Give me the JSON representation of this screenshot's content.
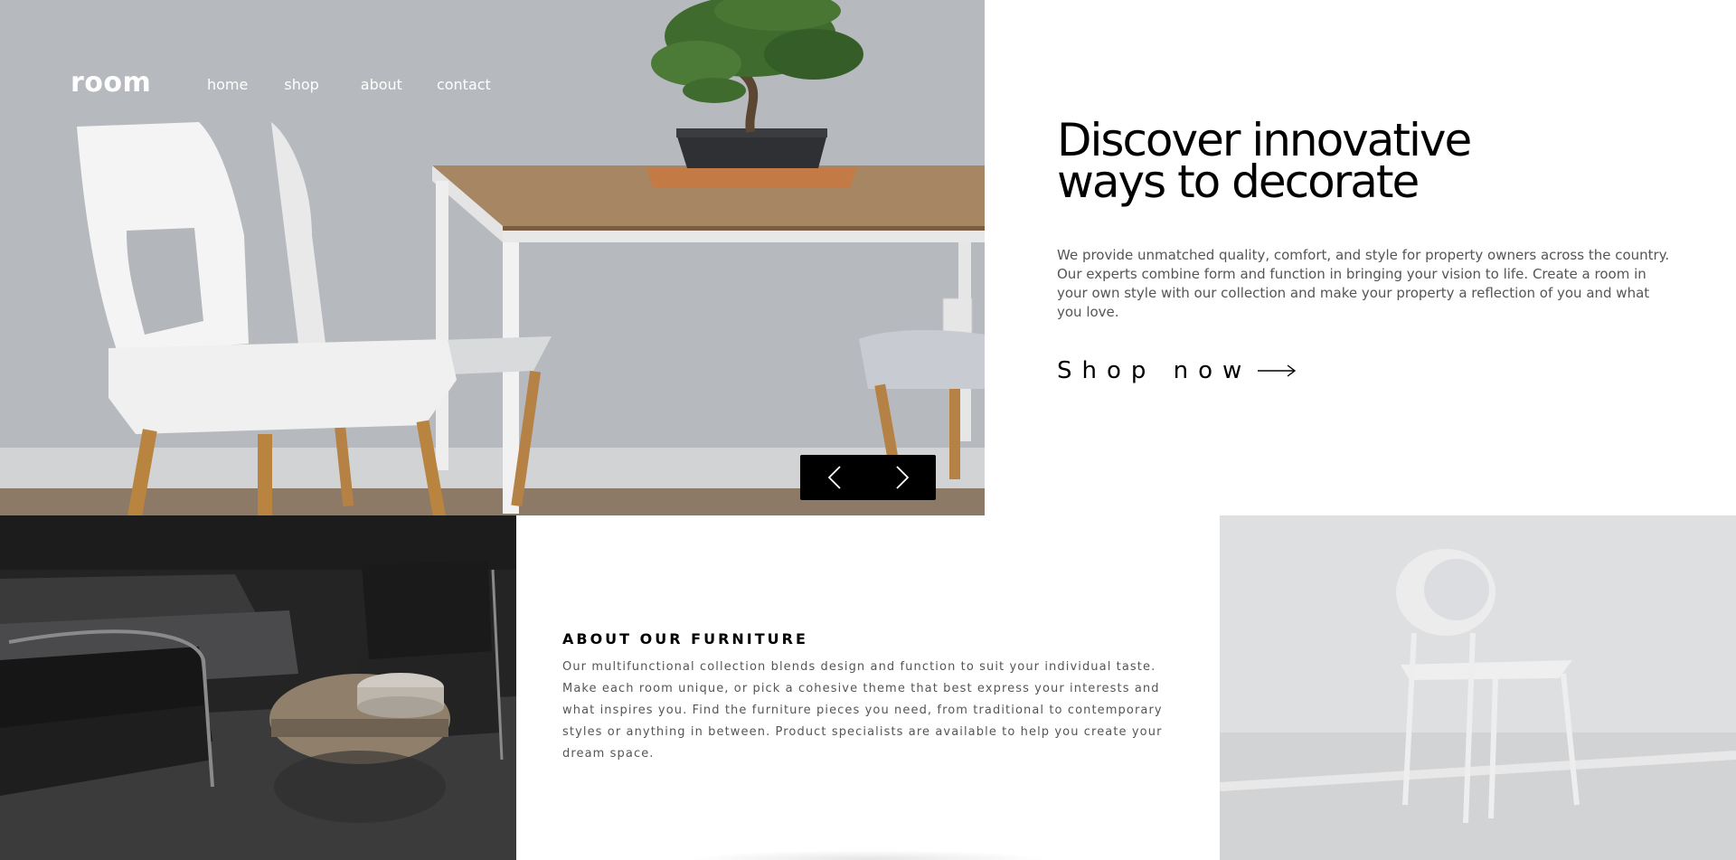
{
  "brand": {
    "logo": "room"
  },
  "nav": {
    "items": [
      {
        "label": "home"
      },
      {
        "label": "shop"
      },
      {
        "label": "about"
      },
      {
        "label": "contact"
      }
    ]
  },
  "hero": {
    "title_line1": "Discover innovative",
    "title_line2": "ways to decorate",
    "description": "We provide unmatched quality, comfort, and style for property owners across the country. Our experts combine form and function in bringing your vision to life. Create a room in your own style with our collection and make your property a reflection of you and what you love.",
    "cta_label": "Shop now",
    "cta_icon": "arrow-right-icon"
  },
  "slider": {
    "prev_icon": "chevron-left-icon",
    "next_icon": "chevron-right-icon"
  },
  "about": {
    "heading": "ABOUT OUR FURNITURE",
    "text": "Our multifunctional collection blends design and function to suit your individual taste. Make each room unique, or pick a cohesive theme that best express your interests and what inspires you. Find the furniture pieces you need, from traditional to contemporary styles or anything in between. Product specialists are available to help you create your dream space."
  },
  "colors": {
    "text_primary": "#000000",
    "text_secondary": "#555555",
    "slider_bg": "#000000",
    "nav_text": "#ffffff"
  }
}
